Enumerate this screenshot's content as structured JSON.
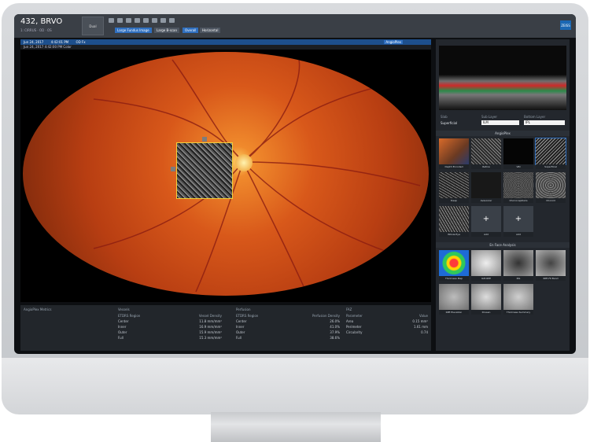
{
  "app": {
    "patient_title": "432, BRVO",
    "patient_subtitle": "1: CIRRUS  ·  OD  ·  OS"
  },
  "toolbar": {
    "left_button_label": "Dual",
    "view_tabs": [
      "Large Fundus Image",
      "Large B-scan",
      "Overall",
      "Horizontal"
    ],
    "logo_text": "ZEISS"
  },
  "viewer": {
    "header_left": "Jun 24, 2017",
    "header_mid": "4:42:01 PM",
    "header_right": "OD Fx",
    "header2": "Jun 24, 2017   4:42:00 PM   Color",
    "angioplex_tab": "AngioPlex"
  },
  "metrics": [
    {
      "title": "AngioPlex Metrics",
      "headers": [
        "",
        ""
      ],
      "rows": []
    },
    {
      "title": "Vessels",
      "headers": [
        "ETDRS Region",
        "Vessel Density"
      ],
      "rows": [
        [
          "Center",
          "11.8 mm/mm²"
        ],
        [
          "Inner",
          "16.9 mm/mm²"
        ],
        [
          "Outer",
          "15.9 mm/mm²"
        ],
        [
          "Full",
          "15.3 mm/mm²"
        ]
      ]
    },
    {
      "title": "Perfusion",
      "headers": [
        "ETDRS Region",
        "Perfusion Density"
      ],
      "rows": [
        [
          "Center",
          "26.0%"
        ],
        [
          "Inner",
          "41.0%"
        ],
        [
          "Outer",
          "37.9%"
        ],
        [
          "Full",
          "38.6%"
        ]
      ]
    },
    {
      "title": "FAZ",
      "headers": [
        "Parameter",
        "Value"
      ],
      "rows": [
        [
          "Area",
          "0.15 mm²"
        ],
        [
          "Perimeter",
          "1.61 mm"
        ],
        [
          "Circularity",
          "0.74"
        ]
      ]
    }
  ],
  "right_panel": {
    "fields": [
      {
        "label": "Slab",
        "value": "Superficial"
      },
      {
        "label": "Sub Layer",
        "value": "ILM"
      },
      {
        "label": "Bottom Layer",
        "value": "IPL"
      }
    ],
    "section_angioplex": "AngioPlex",
    "thumbnails_row1": [
      "Depth Encoded",
      "Retina",
      "VRI",
      "Superficial"
    ],
    "thumbnails_row2": [
      "Deep",
      "Avascular",
      "Choriocapillaris",
      "Choroid"
    ],
    "thumbnails_row3": [
      "Whole Eye",
      "Add",
      "Add"
    ],
    "section_analysis": "En Face Analysis",
    "analysis_row1": [
      "Thickness Map",
      "ILM-RPE",
      "INL",
      "RPE-Fit Band"
    ],
    "analysis_row2": [
      "RPE Elevation",
      "Drusen",
      "Thickness Summary"
    ]
  },
  "colors": {
    "accent": "#2f6fbf",
    "panel": "#23272d",
    "fundus_highlight": "#f2d03a"
  }
}
